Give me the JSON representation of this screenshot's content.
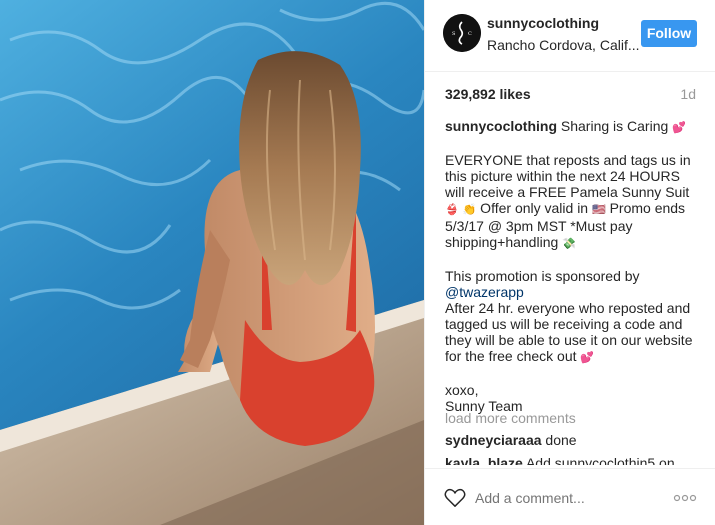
{
  "post": {
    "username": "sunnycoclothing",
    "location": "Rancho Cordova, Calif...",
    "follow_label": "Follow",
    "likes": "329,892 likes",
    "time_ago": "1d"
  },
  "caption": {
    "username": "sunnycoclothing",
    "line1": " Sharing is Caring ",
    "para1": "EVERYONE that reposts and tags us in this picture within the next 24 HOURS will receive a FREE Pamela Sunny Suit ",
    "para1b": " Offer only valid in ",
    "para1c": " Promo ends 5/3/17 @ 3pm MST *Must pay shipping+handling ",
    "para2": "This promotion is sponsored by",
    "mention": "@twazerapp",
    "para3": "After 24 hr. everyone who reposted and tagged us will be receiving a code and they will be able to use it on our website for the free check out ",
    "signoff1": "xoxo,",
    "signoff2": "Sunny Team"
  },
  "comments": {
    "load_more": "load more comments",
    "items": [
      {
        "user": "sydneyciaraaa",
        "text": " done"
      },
      {
        "user": "kayla_blaze",
        "text": " Add sunnycoclothin5 on"
      }
    ]
  },
  "add_comment": {
    "placeholder": "Add a comment..."
  },
  "icons": {
    "heart": "heart-outline-icon",
    "more": "more-options-icon"
  },
  "colors": {
    "follow_button": "#3897f0",
    "swimsuit": "#d9412e",
    "pool": "#2f8fc4"
  }
}
